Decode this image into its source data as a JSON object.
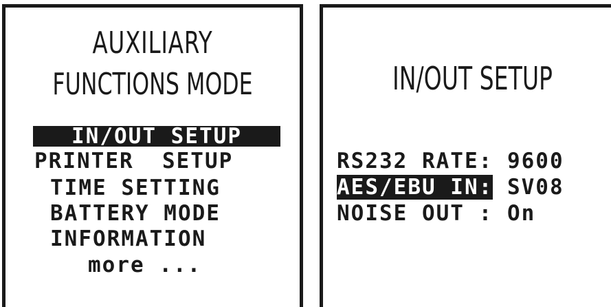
{
  "aux_panel": {
    "title_line_1": "AUXILIARY",
    "title_line_2": "FUNCTIONS MODE",
    "menu_items": [
      {
        "label": "IN/OUT SETUP",
        "selected": true
      },
      {
        "label": "PRINTER  SETUP",
        "selected": false
      },
      {
        "label": "TIME SETTING",
        "selected": false
      },
      {
        "label": "BATTERY MODE",
        "selected": false
      },
      {
        "label": "INFORMATION",
        "selected": false
      },
      {
        "label": "more ...",
        "selected": false
      }
    ]
  },
  "io_panel": {
    "title": "IN/OUT SETUP",
    "settings": [
      {
        "label": "RS232 RATE:",
        "value": "9600",
        "selected": false
      },
      {
        "label": "AES/EBU IN:",
        "value": "SV08",
        "selected": true
      },
      {
        "label": "NOISE OUT :",
        "value": "On",
        "selected": false
      }
    ]
  },
  "colors": {
    "foreground": "#1a1a1a",
    "background": "#ffffff",
    "highlight_text": "#ffffff"
  }
}
